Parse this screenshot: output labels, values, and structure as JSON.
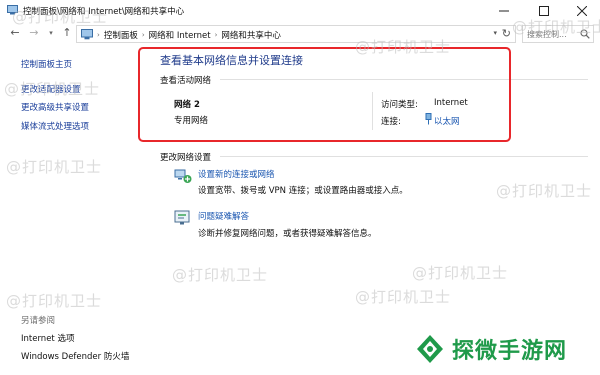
{
  "window": {
    "title": "控制面板\\网络和 Internet\\网络和共享中心"
  },
  "navigation": {
    "breadcrumbs": [
      "控制面板",
      "网络和 Internet",
      "网络和共享中心"
    ],
    "search_placeholder": "搜索控制..."
  },
  "sidebar": {
    "items": [
      "控制面板主页",
      "更改适配器设置",
      "更改高级共享设置",
      "媒体流式处理选项"
    ],
    "see_also_label": "另请参阅",
    "see_also_items": [
      "Internet 选项",
      "Windows Defender 防火墙"
    ]
  },
  "main": {
    "heading": "查看基本网络信息并设置连接",
    "active_networks_label": "查看活动网络",
    "network": {
      "name": "网络 2",
      "type": "专用网络",
      "access_type_label": "访问类型:",
      "access_type_value": "Internet",
      "connection_label": "连接:",
      "connection_value": "以太网"
    },
    "change_settings_label": "更改网络设置",
    "tasks": [
      {
        "title": "设置新的连接或网络",
        "desc": "设置宽带、拨号或 VPN 连接；或设置路由器或接入点。",
        "icon": "new-connection-icon"
      },
      {
        "title": "问题疑难解答",
        "desc": "诊断并修复网络问题，或者获得疑难解答信息。",
        "icon": "troubleshoot-icon"
      }
    ]
  },
  "overlay": {
    "watermark_text": "@打印机卫士",
    "brand_text": "探微手游网",
    "highlight_color": "#e8272b",
    "brand_color": "#1f9a4a"
  }
}
